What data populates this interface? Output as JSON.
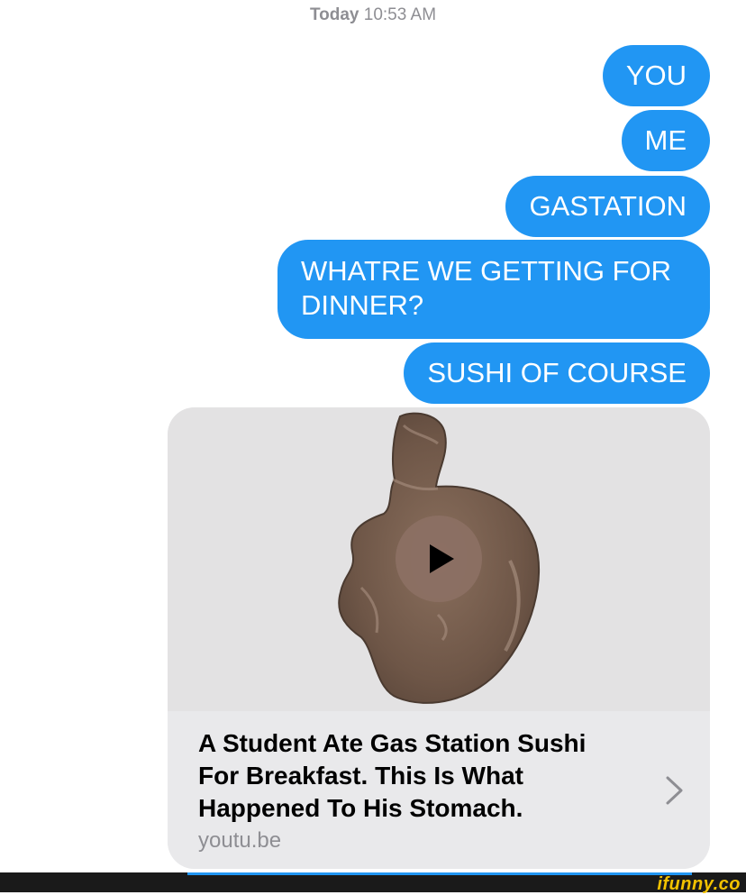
{
  "header": {
    "day": "Today",
    "time": "10:53 AM"
  },
  "messages": [
    {
      "text": "YOU"
    },
    {
      "text": "ME"
    },
    {
      "text": "GASTATION"
    },
    {
      "text": "WHATRE WE GETTING FOR DINNER?"
    },
    {
      "text": "SUSHI OF COURSE"
    }
  ],
  "link_preview": {
    "title": "A Student Ate Gas Station Sushi For Breakfast. This Is What Happened To His Stomach.",
    "domain": "youtu.be",
    "thumbnail_icon": "mushroom-sushi-photo",
    "play_icon": "play-icon",
    "chevron_icon": "chevron-right-icon"
  },
  "watermark": {
    "text": "ifunny.co"
  },
  "colors": {
    "bubble": "#2196f3",
    "card": "#e9e9eb",
    "timestamp": "#8e8e93"
  }
}
